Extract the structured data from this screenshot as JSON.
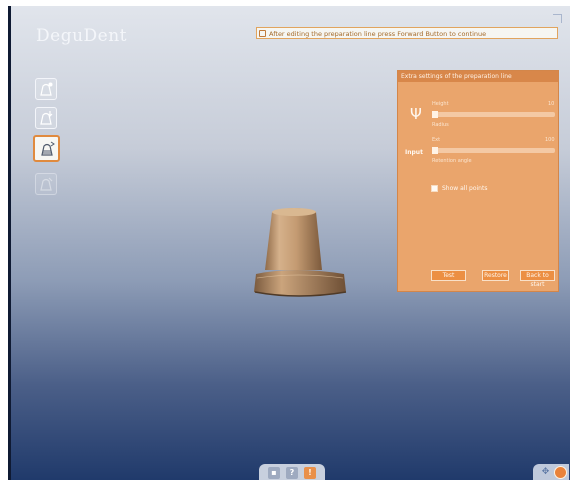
{
  "app": {
    "logo": "DeguDent"
  },
  "hint": {
    "text": "After editing the preparation line press Forward Button to continue"
  },
  "toolbar": {
    "tools": [
      {
        "icon": "bell-badge-icon",
        "state": "normal"
      },
      {
        "icon": "bell-arrow-icon",
        "state": "normal"
      },
      {
        "icon": "bell-layers-icon",
        "state": "active"
      },
      {
        "icon": "bell-edit-icon",
        "state": "disabled"
      }
    ]
  },
  "panel": {
    "title": "Extra settings of the preparation line",
    "param_icon": "Ψ",
    "param_tag": "Input",
    "slider1": {
      "label": "Height",
      "min": "0",
      "max": "10",
      "position": 0.0
    },
    "slider1_sub": "Radius",
    "slider2": {
      "label": "Ext",
      "min": "0",
      "max": "100",
      "position": 0.0
    },
    "slider2_sub": "Retention angle",
    "checkbox_label": "Show all points",
    "buttons": {
      "apply": "Test",
      "restore": "Restore",
      "cancel": "Back to start"
    }
  },
  "bottom_bar": {
    "save": "▪",
    "help": "?",
    "info": "!"
  },
  "bottom_right": {
    "nav": "✥"
  },
  "colors": {
    "accent": "#E08A3E",
    "panel": "#EAA56C",
    "die": "#C9A27A"
  }
}
